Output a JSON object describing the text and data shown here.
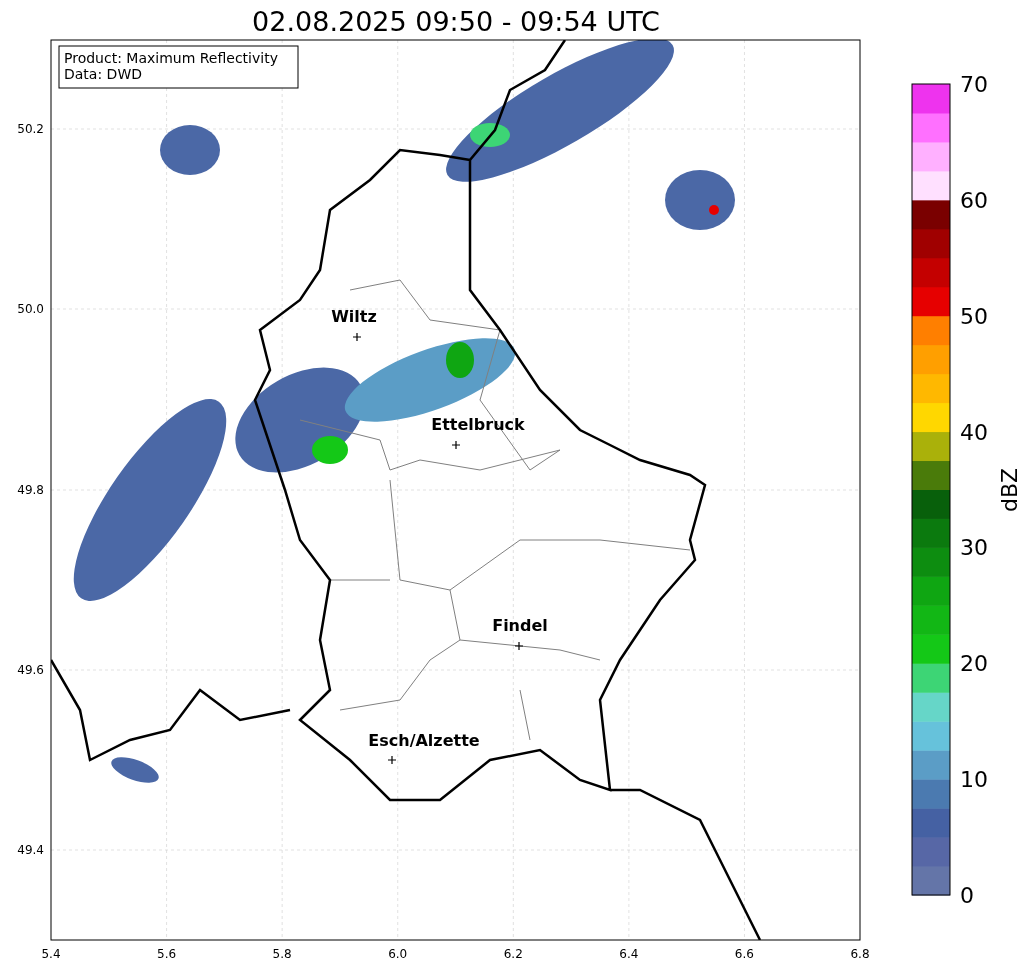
{
  "title": "02.08.2025 09:50 - 09:54 UTC",
  "legend": [
    "Product: Maximum Reflectivity",
    "Data: DWD"
  ],
  "yticks": [
    "50.2",
    "50.0",
    "49.8",
    "49.6",
    "49.4"
  ],
  "xticks": [
    "5.4",
    "5.6",
    "5.8",
    "6.0",
    "6.2",
    "6.4",
    "6.6",
    "6.8"
  ],
  "cities": [
    {
      "name": "Wiltz"
    },
    {
      "name": "Ettelbruck"
    },
    {
      "name": "Findel"
    },
    {
      "name": "Esch/Alzette"
    }
  ],
  "colorbar": {
    "label": "dBZ",
    "ticks": [
      "70",
      "60",
      "50",
      "40",
      "30",
      "20",
      "10",
      "0"
    ]
  }
}
